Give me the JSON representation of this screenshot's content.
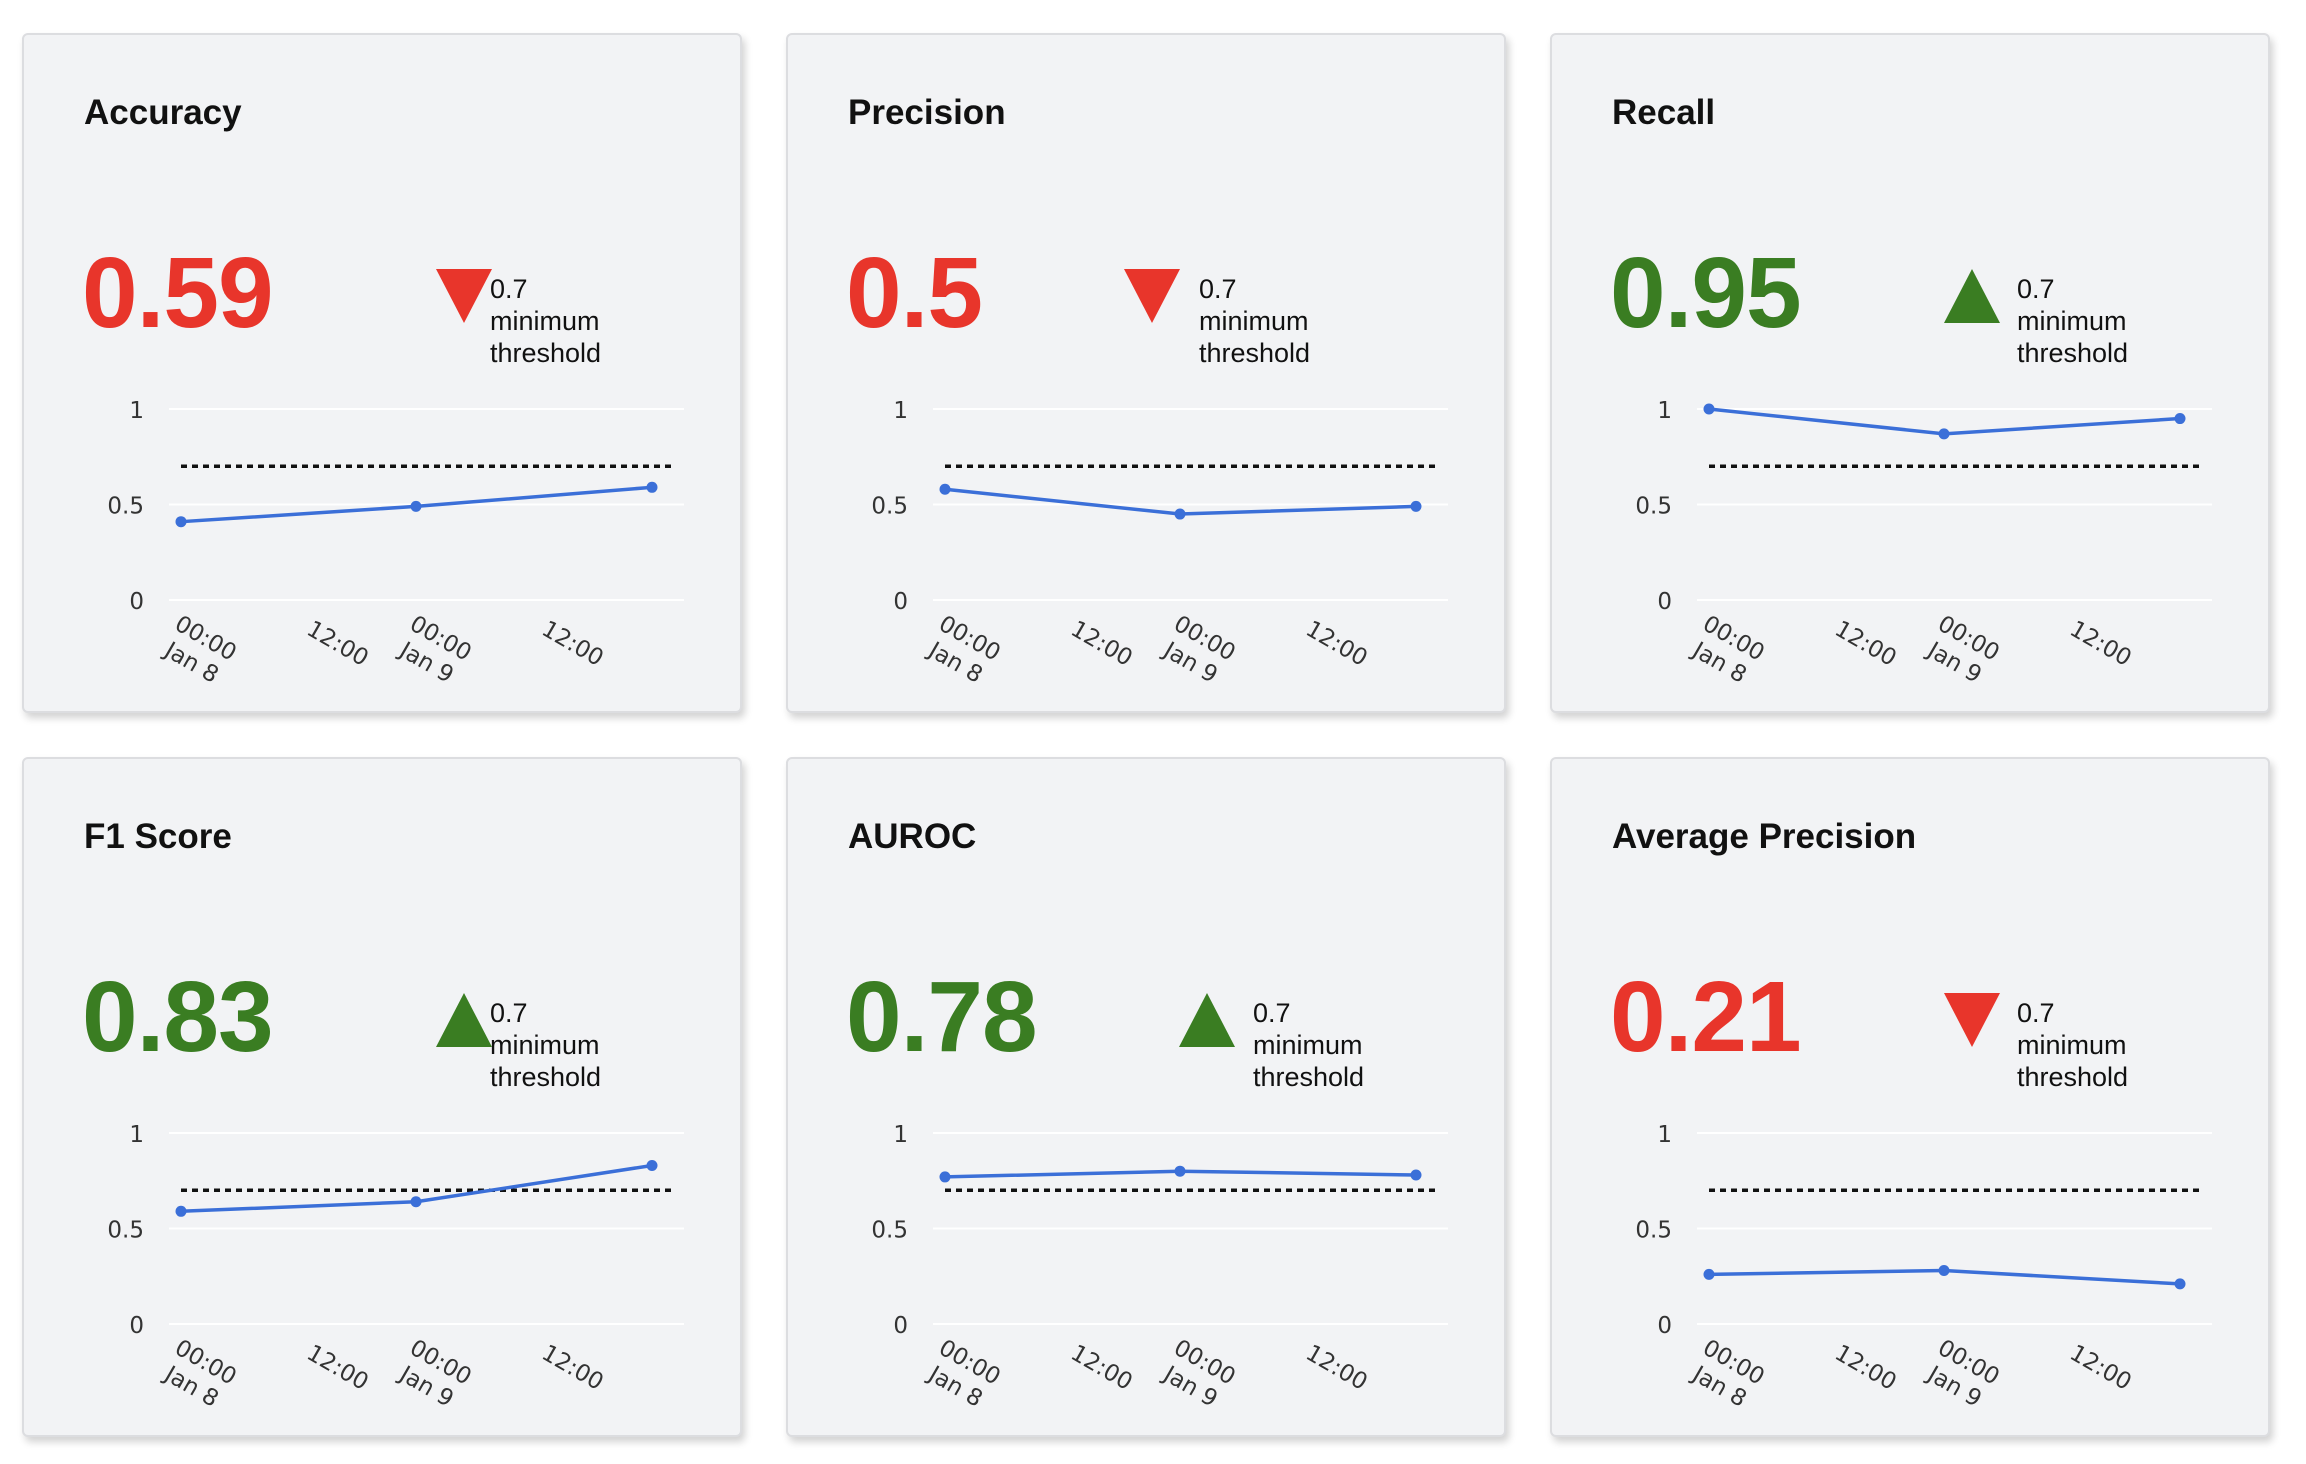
{
  "colors": {
    "good": "#3a7d22",
    "bad": "#e8352b",
    "line": "#3b6fd8",
    "threshold_line": "#111111"
  },
  "threshold": {
    "value": "0.7",
    "line1": "minimum",
    "line2": "threshold"
  },
  "cards": [
    {
      "title": "Accuracy",
      "value": "0.59",
      "status": "bad",
      "trend_icon": "triangle-down-icon"
    },
    {
      "title": "Precision",
      "value": "0.5",
      "status": "bad",
      "trend_icon": "triangle-down-icon"
    },
    {
      "title": "Recall",
      "value": "0.95",
      "status": "good",
      "trend_icon": "triangle-up-icon"
    },
    {
      "title": "F1 Score",
      "value": "0.83",
      "status": "good",
      "trend_icon": "triangle-up-icon"
    },
    {
      "title": "AUROC",
      "value": "0.78",
      "status": "good",
      "trend_icon": "triangle-up-icon"
    },
    {
      "title": "Average Precision",
      "value": "0.21",
      "status": "bad",
      "trend_icon": "triangle-down-icon"
    }
  ],
  "chart_data": [
    {
      "type": "line",
      "series": [
        {
          "values": [
            0.41,
            0.49,
            0.59
          ]
        }
      ],
      "threshold": 0.7,
      "ylim": [
        0,
        1
      ],
      "yticks": [
        "0",
        "0.5",
        "1"
      ],
      "xticks": [
        "00:00\nJan 8",
        "12:00",
        "00:00\nJan 9",
        "12:00"
      ],
      "grid": true
    },
    {
      "type": "line",
      "series": [
        {
          "values": [
            0.58,
            0.45,
            0.49
          ]
        }
      ],
      "threshold": 0.7,
      "ylim": [
        0,
        1
      ],
      "yticks": [
        "0",
        "0.5",
        "1"
      ],
      "xticks": [
        "00:00\nJan 8",
        "12:00",
        "00:00\nJan 9",
        "12:00"
      ],
      "grid": true
    },
    {
      "type": "line",
      "series": [
        {
          "values": [
            1.0,
            0.87,
            0.95
          ]
        }
      ],
      "threshold": 0.7,
      "ylim": [
        0,
        1
      ],
      "yticks": [
        "0",
        "0.5",
        "1"
      ],
      "xticks": [
        "00:00\nJan 8",
        "12:00",
        "00:00\nJan 9",
        "12:00"
      ],
      "grid": true
    },
    {
      "type": "line",
      "series": [
        {
          "values": [
            0.59,
            0.64,
            0.83
          ]
        }
      ],
      "threshold": 0.7,
      "ylim": [
        0,
        1
      ],
      "yticks": [
        "0",
        "0.5",
        "1"
      ],
      "xticks": [
        "00:00\nJan 8",
        "12:00",
        "00:00\nJan 9",
        "12:00"
      ],
      "grid": true
    },
    {
      "type": "line",
      "series": [
        {
          "values": [
            0.77,
            0.8,
            0.78
          ]
        }
      ],
      "threshold": 0.7,
      "ylim": [
        0,
        1
      ],
      "yticks": [
        "0",
        "0.5",
        "1"
      ],
      "xticks": [
        "00:00\nJan 8",
        "12:00",
        "00:00\nJan 9",
        "12:00"
      ],
      "grid": true
    },
    {
      "type": "line",
      "series": [
        {
          "values": [
            0.26,
            0.28,
            0.21
          ]
        }
      ],
      "threshold": 0.7,
      "ylim": [
        0,
        1
      ],
      "yticks": [
        "0",
        "0.5",
        "1"
      ],
      "xticks": [
        "00:00\nJan 8",
        "12:00",
        "00:00\nJan 9",
        "12:00"
      ],
      "grid": true
    }
  ]
}
